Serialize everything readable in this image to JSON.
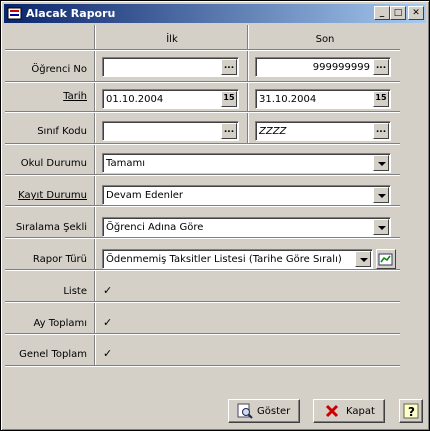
{
  "window": {
    "title": "Alacak Raporu",
    "buttons": [
      "_",
      "□",
      "✕"
    ]
  },
  "headers": {
    "first": "İlk",
    "last": "Son"
  },
  "rows": {
    "ogrenci_no": {
      "label": "Öğrenci No",
      "first": "",
      "last": "999999999"
    },
    "tarih": {
      "label": "Tarih",
      "first": "01.10.2004",
      "last": "31.10.2004",
      "btn": "15"
    },
    "sinif_kodu": {
      "label": "Sınıf Kodu",
      "first": "",
      "last": "ZZZZ"
    },
    "okul_durumu": {
      "label": "Okul Durumu",
      "value": "Tamamı"
    },
    "kayit_durumu": {
      "label": "Kayıt Durumu",
      "value": "Devam Edenler"
    },
    "siralama_sekli": {
      "label": "Sıralama Şekli",
      "value": "Öğrenci Adına Göre"
    },
    "rapor_turu": {
      "label": "Rapor Türü",
      "value": "Ödenmemiş Taksitler Listesi (Tarihe Göre Sıralı)"
    },
    "liste": {
      "label": "Liste",
      "checked": true
    },
    "ay_toplami": {
      "label": "Ay Toplamı",
      "checked": true
    },
    "genel_toplam": {
      "label": "Genel Toplam",
      "checked": true
    }
  },
  "ellipsis": "...",
  "checkmark": "✓",
  "buttons": {
    "goster": "Göster",
    "kapat": "Kapat",
    "help": "?"
  }
}
